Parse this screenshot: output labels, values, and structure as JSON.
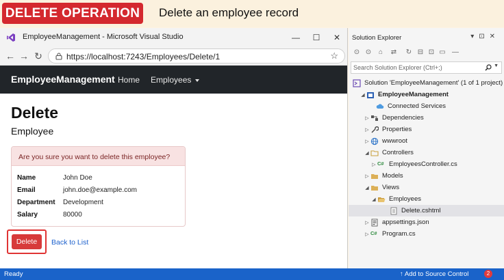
{
  "banner": {
    "badge": "DELETE OPERATION",
    "title": "Delete an employee record"
  },
  "window": {
    "title": "EmployeeManagement - Microsoft Visual Studio",
    "minimize": "—",
    "maximize": "☐",
    "close": "✕"
  },
  "browser": {
    "url": "https://localhost:7243/Employees/Delete/1"
  },
  "app": {
    "brand": "EmployeeManagement",
    "nav": {
      "home": "Home",
      "employees": "Employees"
    },
    "heading": "Delete",
    "subheading": "Employee",
    "confirm": "Are you sure you want to delete this employee?",
    "fields": [
      {
        "label": "Name",
        "value": "John Doe"
      },
      {
        "label": "Email",
        "value": "john.doe@example.com"
      },
      {
        "label": "Department",
        "value": "Development"
      },
      {
        "label": "Salary",
        "value": "80000"
      }
    ],
    "delete_label": "Delete",
    "back_label": "Back to List"
  },
  "explorer": {
    "title": "Solution Explorer",
    "search_placeholder": "Search Solution Explorer (Ctrl+;)",
    "tree": [
      {
        "label": "Solution 'EmployeeManagement' (1 of 1 project)",
        "icon": "solution-icon"
      },
      {
        "label": "EmployeeManagement",
        "icon": "project-icon"
      },
      {
        "label": "Connected Services",
        "icon": "connected-services-icon"
      },
      {
        "label": "Dependencies",
        "icon": "dependencies-icon"
      },
      {
        "label": "Properties",
        "icon": "wrench-icon"
      },
      {
        "label": "wwwroot",
        "icon": "globe-icon"
      },
      {
        "label": "Controllers",
        "icon": "folder-icon"
      },
      {
        "label": "EmployeesController.cs",
        "icon": "csharp-file-icon"
      },
      {
        "label": "Models",
        "icon": "folder-icon"
      },
      {
        "label": "Views",
        "icon": "folder-icon"
      },
      {
        "label": "Employees",
        "icon": "folder-open-icon"
      },
      {
        "label": "Delete.cshtml",
        "icon": "razor-file-icon"
      },
      {
        "label": "appsettings.json",
        "icon": "json-file-icon"
      },
      {
        "label": "Program.cs",
        "icon": "csharp-file-icon"
      }
    ],
    "cs_glyph": "C#"
  },
  "status": {
    "ready": "Ready",
    "source_control": "↑  Add to Source Control",
    "notifications": "2"
  },
  "colors": {
    "badge": "#d4282e",
    "status_bar": "#1a63c9",
    "nav_bg": "#212529",
    "delete_button": "#d73a3a"
  }
}
